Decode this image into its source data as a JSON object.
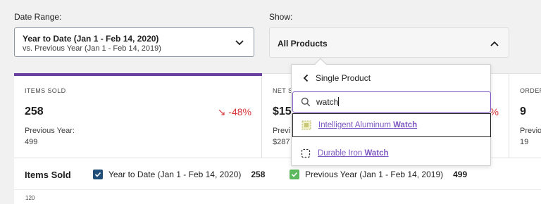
{
  "filters": {
    "date_range_label": "Date Range:",
    "date_primary": "Year to Date (Jan 1 - Feb 14, 2020)",
    "date_secondary": "vs. Previous Year (Jan 1 - Feb 14, 2019)",
    "show_label": "Show:",
    "show_value": "All Products"
  },
  "tiles": [
    {
      "label": "ITEMS SOLD",
      "value": "258",
      "delta": "↘ -48%",
      "prev_label": "Previous Year:",
      "prev_value": "499",
      "active": true
    },
    {
      "label": "NET S",
      "value": "$15",
      "delta": "%",
      "prev_label": "Previ",
      "prev_value": "$287"
    },
    {
      "label": "ORDER",
      "value": "9",
      "prev_label": "Previo",
      "prev_value": "19"
    }
  ],
  "chart": {
    "title": "Items Sold",
    "legend": [
      {
        "label": "Year to Date (Jan 1 - Feb 14, 2020)",
        "total": "258",
        "color": "#1f4e79"
      },
      {
        "label": "Previous Year (Jan 1 - Feb 14, 2019)",
        "total": "499",
        "color": "#5cb85c"
      }
    ],
    "first_tick": "120"
  },
  "dropdown": {
    "back_label": "Single Product",
    "search_value": "watch",
    "results": [
      {
        "prefix": "Intelligent Aluminum ",
        "match": "Watch",
        "selected": true
      },
      {
        "prefix": "Durable Iron ",
        "match": "Watch",
        "selected": false
      }
    ]
  },
  "colors": {
    "accent": "#7e57c2",
    "active_tile_bar": "#6b3fa0",
    "negative_delta": "#d63638",
    "legend_primary": "#1f4e79",
    "legend_secondary": "#5cb85c"
  }
}
